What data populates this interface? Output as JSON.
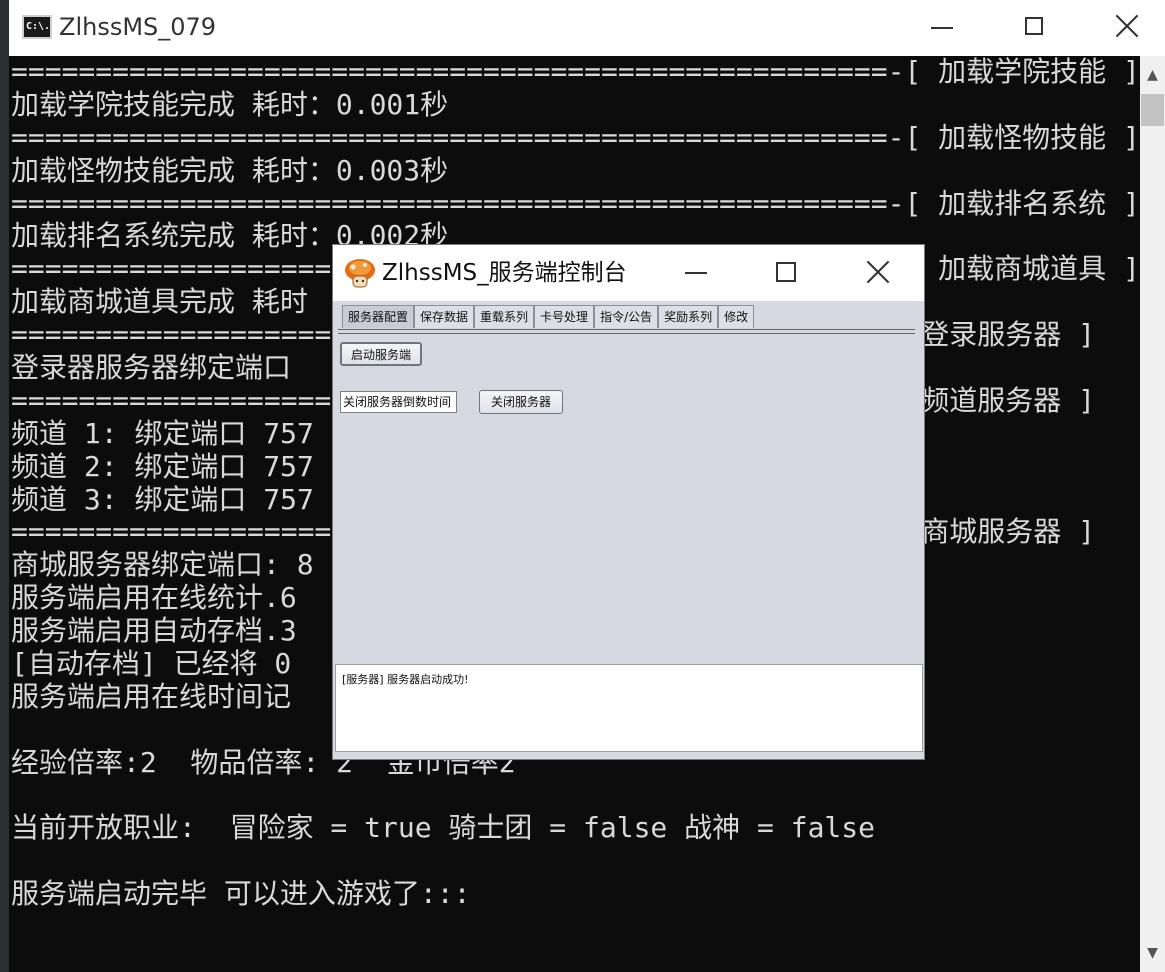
{
  "console": {
    "title": "ZlhssMS_079",
    "icon_text": "C:\\.",
    "lines": [
      "====================================================-[ 加载学院技能 ]",
      "加载学院技能完成 耗时：0.001秒",
      "====================================================-[ 加载怪物技能 ]",
      "加载怪物技能完成 耗时：0.003秒",
      "====================================================-[ 加载排名系统 ]",
      "加载排名系统完成 耗时：0.002秒",
      "====================================================-[ 加载商城道具 ]",
      "加载商城道具完成 耗时",
      "===================================================-[ 登录服务器 ]",
      "登录器服务器绑定端口",
      "===================================================-[ 频道服务器 ]",
      "频道 1: 绑定端口 757",
      "频道 2: 绑定端口 757",
      "频道 3: 绑定端口 757",
      "===================================================-[ 商城服务器 ]",
      "商城服务器绑定端口: 8",
      "服务端启用在线统计.6",
      "服务端启用自动存档.3",
      "[自动存档] 已经将 0",
      "服务端启用在线时间记",
      "",
      "经验倍率:2  物品倍率: 2  金币倍率2",
      "",
      "当前开放职业:  冒险家 = true 骑士团 = false 战神 = false",
      "",
      "服务端启动完毕 可以进入游戏了:::",
      "",
      ""
    ]
  },
  "dialog": {
    "title": "ZlhssMS_服务端控制台",
    "tabs": [
      "服务器配置",
      "保存数据",
      "重载系列",
      "卡号处理",
      "指令/公告",
      "奖励系列",
      "修改"
    ],
    "start_button": "启动服务端",
    "countdown_input_value": "关闭服务器倒数时间",
    "shutdown_button": "关闭服务器",
    "log": "[服务器] 服务器启动成功!"
  },
  "colors": {
    "console_bg": "#0c0c0c",
    "console_text": "#d9d9d9",
    "dialog_bg": "#d6d9df"
  }
}
